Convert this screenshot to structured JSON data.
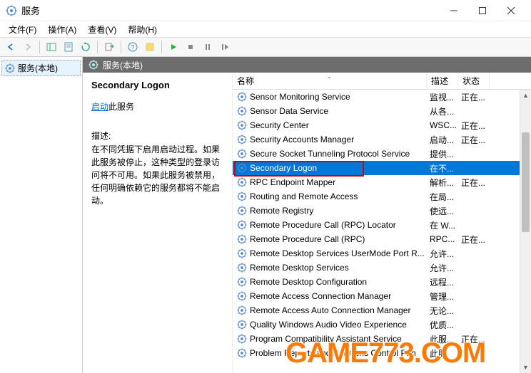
{
  "window": {
    "title": "服务"
  },
  "menu": {
    "file": "文件(F)",
    "action": "操作(A)",
    "view": "查看(V)",
    "help": "帮助(H)"
  },
  "tree": {
    "root": "服务(本地)"
  },
  "right_header": "服务(本地)",
  "detail": {
    "title": "Secondary Logon",
    "link_prefix": "启动",
    "link_suffix": "此服务",
    "desc_label": "描述:",
    "desc_text": "在不同凭据下启用启动过程。如果此服务被停止，这种类型的登录访问将不可用。如果此服务被禁用，任何明确依赖它的服务都将不能启动。"
  },
  "columns": {
    "name": "名称",
    "desc": "描述",
    "state": "状态"
  },
  "services": [
    {
      "name": "Sensor Monitoring Service",
      "desc": "监视...",
      "state": "正在..."
    },
    {
      "name": "Sensor Data Service",
      "desc": "从各...",
      "state": ""
    },
    {
      "name": "Security Center",
      "desc": "WSC...",
      "state": "正在..."
    },
    {
      "name": "Security Accounts Manager",
      "desc": "启动...",
      "state": "正在..."
    },
    {
      "name": "Secure Socket Tunneling Protocol Service",
      "desc": "提供...",
      "state": ""
    },
    {
      "name": "Secondary Logon",
      "desc": "在不...",
      "state": "",
      "selected": true
    },
    {
      "name": "RPC Endpoint Mapper",
      "desc": "解析...",
      "state": "正在..."
    },
    {
      "name": "Routing and Remote Access",
      "desc": "在局...",
      "state": ""
    },
    {
      "name": "Remote Registry",
      "desc": "使远...",
      "state": ""
    },
    {
      "name": "Remote Procedure Call (RPC) Locator",
      "desc": "在 W...",
      "state": ""
    },
    {
      "name": "Remote Procedure Call (RPC)",
      "desc": "RPC...",
      "state": "正在..."
    },
    {
      "name": "Remote Desktop Services UserMode Port R...",
      "desc": "允许...",
      "state": ""
    },
    {
      "name": "Remote Desktop Services",
      "desc": "允许...",
      "state": ""
    },
    {
      "name": "Remote Desktop Configuration",
      "desc": "远程...",
      "state": ""
    },
    {
      "name": "Remote Access Connection Manager",
      "desc": "管理...",
      "state": ""
    },
    {
      "name": "Remote Access Auto Connection Manager",
      "desc": "无论...",
      "state": ""
    },
    {
      "name": "Quality Windows Audio Video Experience",
      "desc": "优质...",
      "state": ""
    },
    {
      "name": "Program Compatibility Assistant Service",
      "desc": "此服...",
      "state": "正在..."
    },
    {
      "name": "Problem Reports and Solutions Control Pan",
      "desc": "此服",
      "state": ""
    }
  ],
  "watermark": "GAME773.COM"
}
